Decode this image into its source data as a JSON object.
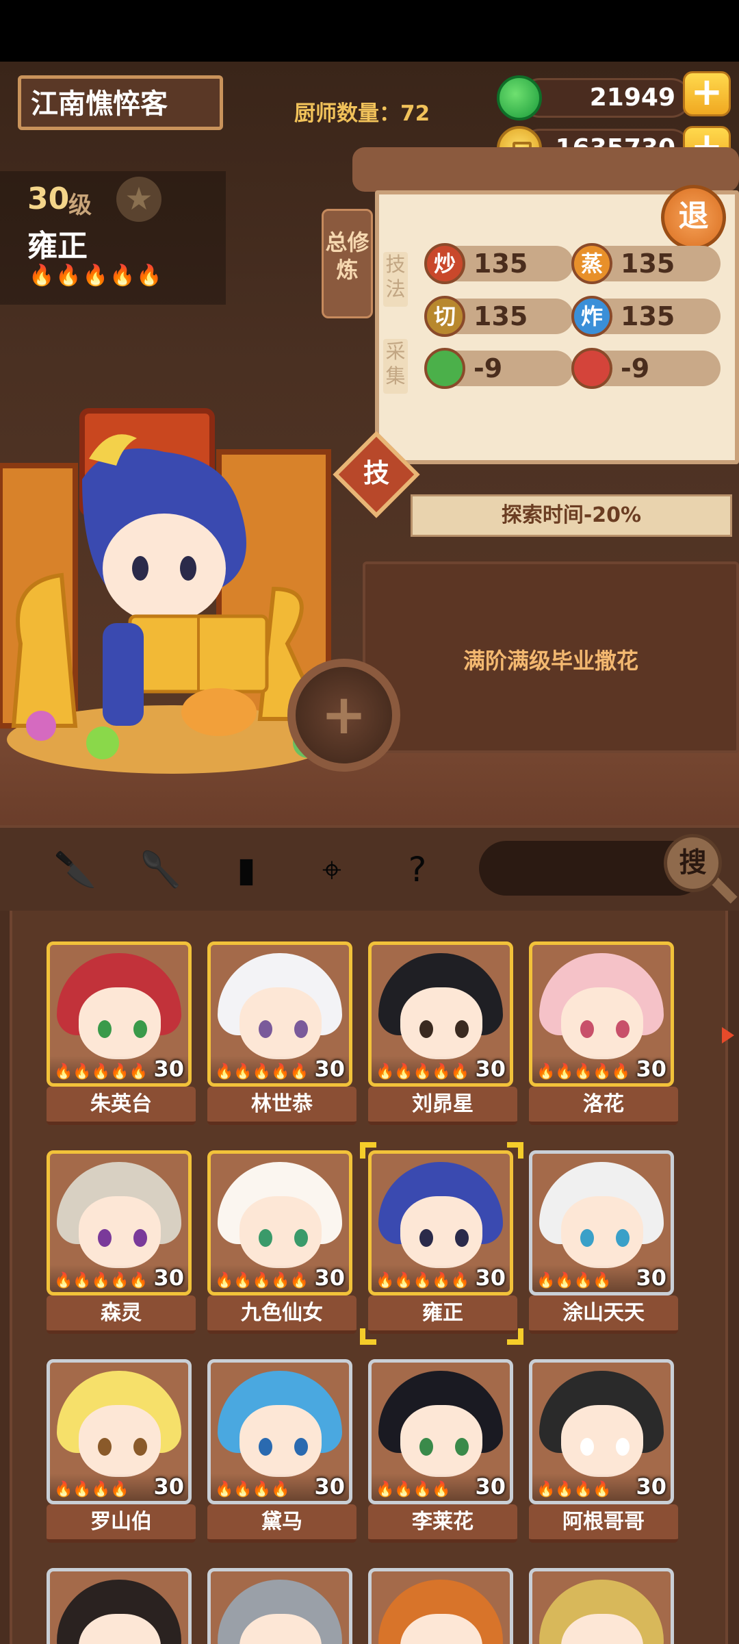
{
  "header": {
    "player_name": "江南憔悴客",
    "chef_count": "厨师数量：72",
    "jade": "21949",
    "coins": "1635730",
    "plus_icon": "plus-icon"
  },
  "chef": {
    "level_num": "30",
    "level_unit": "级",
    "name": "雍正",
    "fires": "🔥🔥🔥🔥🔥"
  },
  "info_panel": {
    "tab_label": "总修炼",
    "exit_label": "退",
    "skill_section": "技法",
    "gather_section": "采集",
    "stats": [
      {
        "icon": "炒",
        "value": "135",
        "color": "#c9482b"
      },
      {
        "icon": "蒸",
        "value": "135",
        "color": "#e8902a"
      },
      {
        "icon": "切",
        "value": "135",
        "color": "#b8882e"
      },
      {
        "icon": "炸",
        "value": "135",
        "color": "#3a8fd8"
      }
    ],
    "gather": [
      {
        "icon": "vegetable-icon",
        "value": "-9",
        "color": "#4bb04a"
      },
      {
        "icon": "meat-icon",
        "value": "-9",
        "color": "#d4443a"
      }
    ],
    "skill_button": "技",
    "explore_bonus": "探索时间-20%",
    "description": "满阶满级毕业撒花",
    "add_label": "+"
  },
  "toolbar": {
    "icons": [
      "knife-icon",
      "spatula-icon",
      "jar-icon",
      "location-icon",
      "help-map-icon"
    ],
    "search_label": "搜"
  },
  "chef_grid": [
    {
      "name": "朱英台",
      "level": "30",
      "fires": "🔥🔥🔥🔥🔥",
      "rarity": "gold",
      "hair": "#c2323a",
      "eye": "#3a9a4a"
    },
    {
      "name": "林世恭",
      "level": "30",
      "fires": "🔥🔥🔥🔥🔥",
      "rarity": "gold",
      "hair": "#f3f3f6",
      "eye": "#7a5a9a"
    },
    {
      "name": "刘昴星",
      "level": "30",
      "fires": "🔥🔥🔥🔥🔥",
      "rarity": "gold",
      "hair": "#1f1f24",
      "eye": "#3a2a20"
    },
    {
      "name": "洛花",
      "level": "30",
      "fires": "🔥🔥🔥🔥🔥",
      "rarity": "gold",
      "hair": "#f5c2c8",
      "eye": "#c8506a"
    },
    {
      "name": "森灵",
      "level": "30",
      "fires": "🔥🔥🔥🔥🔥",
      "rarity": "gold",
      "hair": "#d8d0c2",
      "eye": "#7a3a9a"
    },
    {
      "name": "九色仙女",
      "level": "30",
      "fires": "🔥🔥🔥🔥🔥",
      "rarity": "gold",
      "hair": "#fbf6f0",
      "eye": "#3a9a6a"
    },
    {
      "name": "雍正",
      "level": "30",
      "fires": "🔥🔥🔥🔥🔥",
      "rarity": "gold",
      "hair": "#3a4ab0",
      "eye": "#2a2a4a",
      "selected": true
    },
    {
      "name": "涂山天天",
      "level": "30",
      "fires": "🔥🔥🔥🔥",
      "rarity": "silver",
      "hair": "#f0f0f0",
      "eye": "#3aa0c8"
    },
    {
      "name": "罗山伯",
      "level": "30",
      "fires": "🔥🔥🔥🔥",
      "rarity": "silver",
      "hair": "#f6e06a",
      "eye": "#8a5a2a"
    },
    {
      "name": "黛马",
      "level": "30",
      "fires": "🔥🔥🔥🔥",
      "rarity": "silver",
      "hair": "#4aa8e0",
      "eye": "#2a6ab0"
    },
    {
      "name": "李莱花",
      "level": "30",
      "fires": "🔥🔥🔥🔥",
      "rarity": "silver",
      "hair": "#1a1a22",
      "eye": "#3a8a4a"
    },
    {
      "name": "阿根哥哥",
      "level": "30",
      "fires": "🔥🔥🔥🔥",
      "rarity": "silver",
      "hair": "#2a2a2a",
      "eye": "#ffffff"
    },
    {
      "name": "",
      "level": "",
      "fires": "",
      "rarity": "silver",
      "hair": "#2a2220",
      "eye": "#2a2220"
    },
    {
      "name": "",
      "level": "",
      "fires": "",
      "rarity": "silver",
      "hair": "#9aa0a8",
      "eye": "#2a2a2a"
    },
    {
      "name": "",
      "level": "",
      "fires": "",
      "rarity": "silver",
      "hair": "#d8742a",
      "eye": "#2a2a2a"
    },
    {
      "name": "",
      "level": "",
      "fires": "",
      "rarity": "silver",
      "hair": "#d8b85a",
      "eye": "#2a2a2a"
    }
  ]
}
